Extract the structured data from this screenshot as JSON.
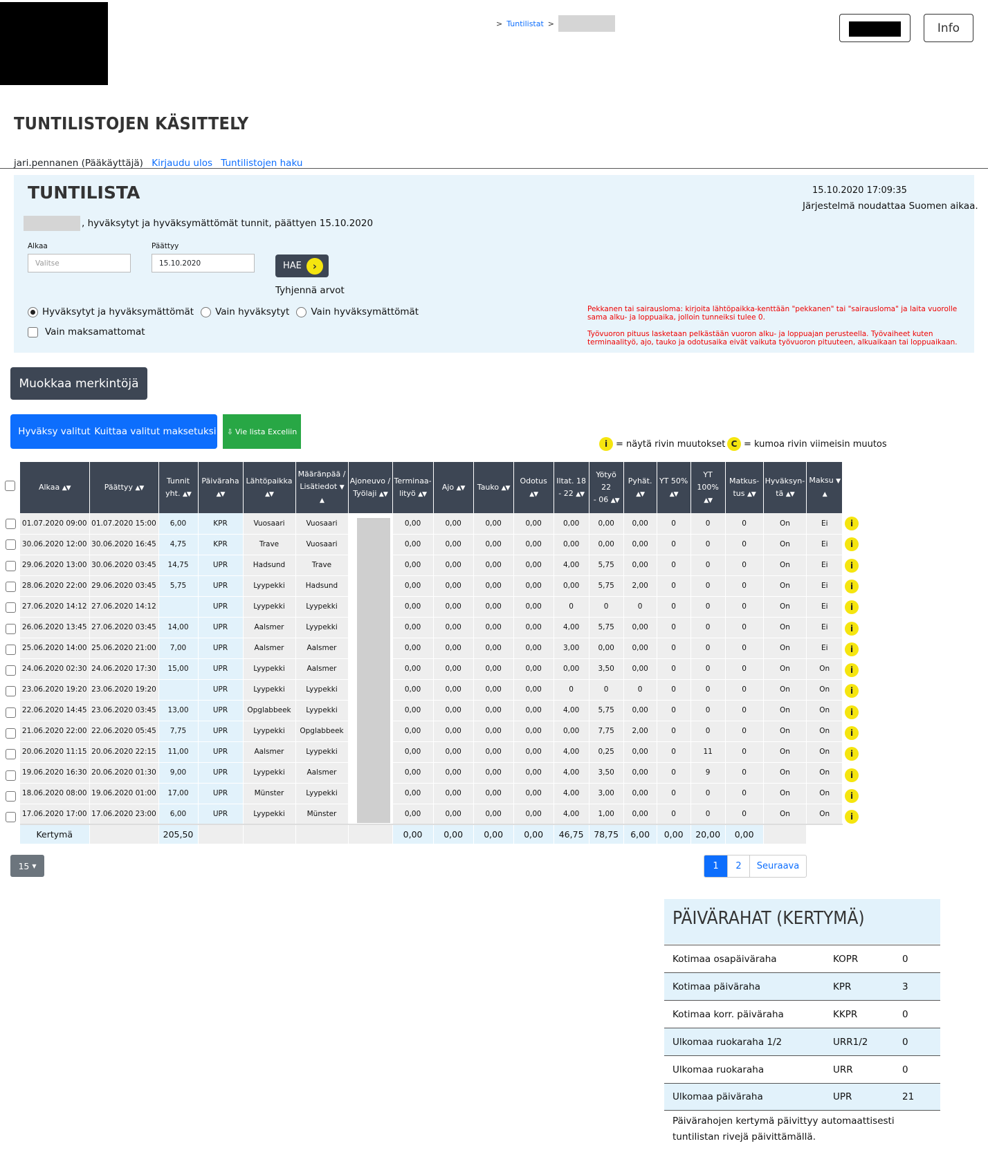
{
  "header": {
    "breadcrumb_sep1": ">",
    "breadcrumb_link": "Tuntilistat",
    "breadcrumb_sep2": ">",
    "info_button": "Info"
  },
  "page_title": "TUNTILISTOJEN KÄSITTELY",
  "user": {
    "name": "jari.pennanen (Pääkäyttäjä)",
    "logout": "Kirjaudu ulos",
    "search_link": "Tuntilistojen haku"
  },
  "panel": {
    "title": "TUNTILISTA",
    "datetime": "15.10.2020 17:09:35",
    "timezone_note": "Järjestelmä noudattaa Suomen aikaa.",
    "description": ", hyväksytyt ja hyväksymättömät tunnit, päättyen 15.10.2020",
    "start_label": "Alkaa",
    "start_placeholder": "Valitse",
    "end_label": "Päättyy",
    "end_value": "15.10.2020",
    "search_button": "HAE",
    "clear_label": "Tyhjennä arvot",
    "radio_all": "Hyväksytyt ja hyväksymättömät",
    "radio_approved": "Vain hyväksytyt",
    "radio_unapproved": "Vain hyväksymättömät",
    "unpaid_only": "Vain maksamattomat",
    "note1": "Pekkanen tai sairausloma: kirjoita lähtöpaikka-kenttään \"pekkanen\" tai \"sairausloma\" ja laita vuorolle sama alku- ja loppuaika, jolloin tunneiksi tulee 0.",
    "note2": "Työvuoron pituus lasketaan pelkästään vuoron alku- ja loppuajan perusteella. Työvaiheet kuten terminaalityö, ajo, tauko ja odotusaika eivät vaikuta työvuoron pituuteen, alkuaikaan tai loppuaikaan."
  },
  "actions": {
    "edit": "Muokkaa merkintöjä",
    "approve": "Hyväksy valitut",
    "mark_paid": "Kuittaa valitut maksetuksi",
    "export": "Vie lista Exceliin",
    "legend_info": "= näytä rivin muutokset",
    "legend_undo": "= kumoa rivin viimeisin muutos",
    "info_glyph": "i",
    "undo_glyph": "C"
  },
  "table": {
    "headers": {
      "start": "Alkaa",
      "end": "Päättyy",
      "hours_1": "Tunnit",
      "hours_2": "yht.",
      "allowance": "Päiväraha",
      "from": "Lähtöpaikka",
      "dest_1": "Määränpää /",
      "dest_2": "Lisätiedot",
      "vehicle_1": "Ajoneuvo /",
      "vehicle_2": "Työlaji",
      "terminal_1": "Terminaa-",
      "terminal_2": "lityö",
      "drive": "Ajo",
      "break": "Tauko",
      "wait": "Odotus",
      "evening_1": "Iltat. 18",
      "evening_2": "- 22",
      "night_1": "Yötyö 22",
      "night_2": "- 06",
      "holiday": "Pyhät.",
      "yt50": "YT 50%",
      "yt100": "YT 100%",
      "travel_1": "Matkus-",
      "travel_2": "tus",
      "approved_1": "Hyväksyn-",
      "approved_2": "tä",
      "paid": "Maksu"
    },
    "rows": [
      [
        "01.07.2020 09:00",
        "01.07.2020 15:00",
        "6,00",
        "KPR",
        "Vuosaari",
        "Vuosaari",
        "",
        "0,00",
        "0,00",
        "0,00",
        "0,00",
        "0,00",
        "0,00",
        "0,00",
        "0",
        "0",
        "0",
        "On",
        "Ei"
      ],
      [
        "30.06.2020 12:00",
        "30.06.2020 16:45",
        "4,75",
        "KPR",
        "Trave",
        "Vuosaari",
        "",
        "0,00",
        "0,00",
        "0,00",
        "0,00",
        "0,00",
        "0,00",
        "0,00",
        "0",
        "0",
        "0",
        "On",
        "Ei"
      ],
      [
        "29.06.2020 13:00",
        "30.06.2020 03:45",
        "14,75",
        "UPR",
        "Hadsund",
        "Trave",
        "",
        "0,00",
        "0,00",
        "0,00",
        "0,00",
        "4,00",
        "5,75",
        "0,00",
        "0",
        "0",
        "0",
        "On",
        "Ei"
      ],
      [
        "28.06.2020 22:00",
        "29.06.2020 03:45",
        "5,75",
        "UPR",
        "Lyypekki",
        "Hadsund",
        "",
        "0,00",
        "0,00",
        "0,00",
        "0,00",
        "0,00",
        "5,75",
        "2,00",
        "0",
        "0",
        "0",
        "On",
        "Ei"
      ],
      [
        "27.06.2020 14:12",
        "27.06.2020 14:12",
        "",
        "UPR",
        "Lyypekki",
        "Lyypekki",
        "",
        "0,00",
        "0,00",
        "0,00",
        "0,00",
        "0",
        "0",
        "0",
        "0",
        "0",
        "0",
        "On",
        "Ei"
      ],
      [
        "26.06.2020 13:45",
        "27.06.2020 03:45",
        "14,00",
        "UPR",
        "Aalsmer",
        "Lyypekki",
        "",
        "0,00",
        "0,00",
        "0,00",
        "0,00",
        "4,00",
        "5,75",
        "0,00",
        "0",
        "0",
        "0",
        "On",
        "Ei"
      ],
      [
        "25.06.2020 14:00",
        "25.06.2020 21:00",
        "7,00",
        "UPR",
        "Aalsmer",
        "Aalsmer",
        "",
        "0,00",
        "0,00",
        "0,00",
        "0,00",
        "3,00",
        "0,00",
        "0,00",
        "0",
        "0",
        "0",
        "On",
        "Ei"
      ],
      [
        "24.06.2020 02:30",
        "24.06.2020 17:30",
        "15,00",
        "UPR",
        "Lyypekki",
        "Aalsmer",
        "",
        "0,00",
        "0,00",
        "0,00",
        "0,00",
        "0,00",
        "3,50",
        "0,00",
        "0",
        "0",
        "0",
        "On",
        "On"
      ],
      [
        "23.06.2020 19:20",
        "23.06.2020 19:20",
        "",
        "UPR",
        "Lyypekki",
        "Lyypekki",
        "",
        "0,00",
        "0,00",
        "0,00",
        "0,00",
        "0",
        "0",
        "0",
        "0",
        "0",
        "0",
        "On",
        "On"
      ],
      [
        "22.06.2020 14:45",
        "23.06.2020 03:45",
        "13,00",
        "UPR",
        "Opglabbeek",
        "Lyypekki",
        "",
        "0,00",
        "0,00",
        "0,00",
        "0,00",
        "4,00",
        "5,75",
        "0,00",
        "0",
        "0",
        "0",
        "On",
        "On"
      ],
      [
        "21.06.2020 22:00",
        "22.06.2020 05:45",
        "7,75",
        "UPR",
        "Lyypekki",
        "Opglabbeek",
        "",
        "0,00",
        "0,00",
        "0,00",
        "0,00",
        "0,00",
        "7,75",
        "2,00",
        "0",
        "0",
        "0",
        "On",
        "On"
      ],
      [
        "20.06.2020 11:15",
        "20.06.2020 22:15",
        "11,00",
        "UPR",
        "Aalsmer",
        "Lyypekki",
        "",
        "0,00",
        "0,00",
        "0,00",
        "0,00",
        "4,00",
        "0,25",
        "0,00",
        "0",
        "11",
        "0",
        "On",
        "On"
      ],
      [
        "19.06.2020 16:30",
        "20.06.2020 01:30",
        "9,00",
        "UPR",
        "Lyypekki",
        "Aalsmer",
        "",
        "0,00",
        "0,00",
        "0,00",
        "0,00",
        "4,00",
        "3,50",
        "0,00",
        "0",
        "9",
        "0",
        "On",
        "On"
      ],
      [
        "18.06.2020 08:00",
        "19.06.2020 01:00",
        "17,00",
        "UPR",
        "Münster",
        "Lyypekki",
        "",
        "0,00",
        "0,00",
        "0,00",
        "0,00",
        "4,00",
        "3,00",
        "0,00",
        "0",
        "0",
        "0",
        "On",
        "On"
      ],
      [
        "17.06.2020 17:00",
        "17.06.2020 23:00",
        "6,00",
        "UPR",
        "Lyypekki",
        "Münster",
        "",
        "0,00",
        "0,00",
        "0,00",
        "0,00",
        "4,00",
        "1,00",
        "0,00",
        "0",
        "0",
        "0",
        "On",
        "On"
      ]
    ],
    "totals": {
      "label": "Kertymä",
      "hours": "205,50",
      "terminal": "0,00",
      "drive": "0,00",
      "break": "0,00",
      "wait": "0,00",
      "evening": "46,75",
      "night": "78,75",
      "holiday": "6,00",
      "yt50": "0,00",
      "yt100": "20,00",
      "travel": "0,00"
    }
  },
  "pagination": {
    "page_size": "15",
    "page1": "1",
    "page2": "2",
    "next": "Seuraava"
  },
  "allowances": {
    "title": "PÄIVÄRAHAT (KERTYMÄ)",
    "rows": [
      {
        "name": "Kotimaa osapäiväraha",
        "code": "KOPR",
        "count": "0"
      },
      {
        "name": "Kotimaa päiväraha",
        "code": "KPR",
        "count": "3"
      },
      {
        "name": "Kotimaa korr. päiväraha",
        "code": "KKPR",
        "count": "0"
      },
      {
        "name": "Ulkomaa ruokaraha 1/2",
        "code": "URR1/2",
        "count": "0"
      },
      {
        "name": "Ulkomaa ruokaraha",
        "code": "URR",
        "count": "0"
      },
      {
        "name": "Ulkomaa päiväraha",
        "code": "UPR",
        "count": "21"
      }
    ],
    "footnote": "Päivärahojen kertymä päivittyy automaattisesti tuntilistan rivejä päivittämällä."
  },
  "colors": {
    "header_dark": "#3d4654",
    "primary": "#0d6efd",
    "success": "#28a745",
    "panel_bg": "#e8f4fb",
    "badge_yellow": "#f5e50f"
  }
}
